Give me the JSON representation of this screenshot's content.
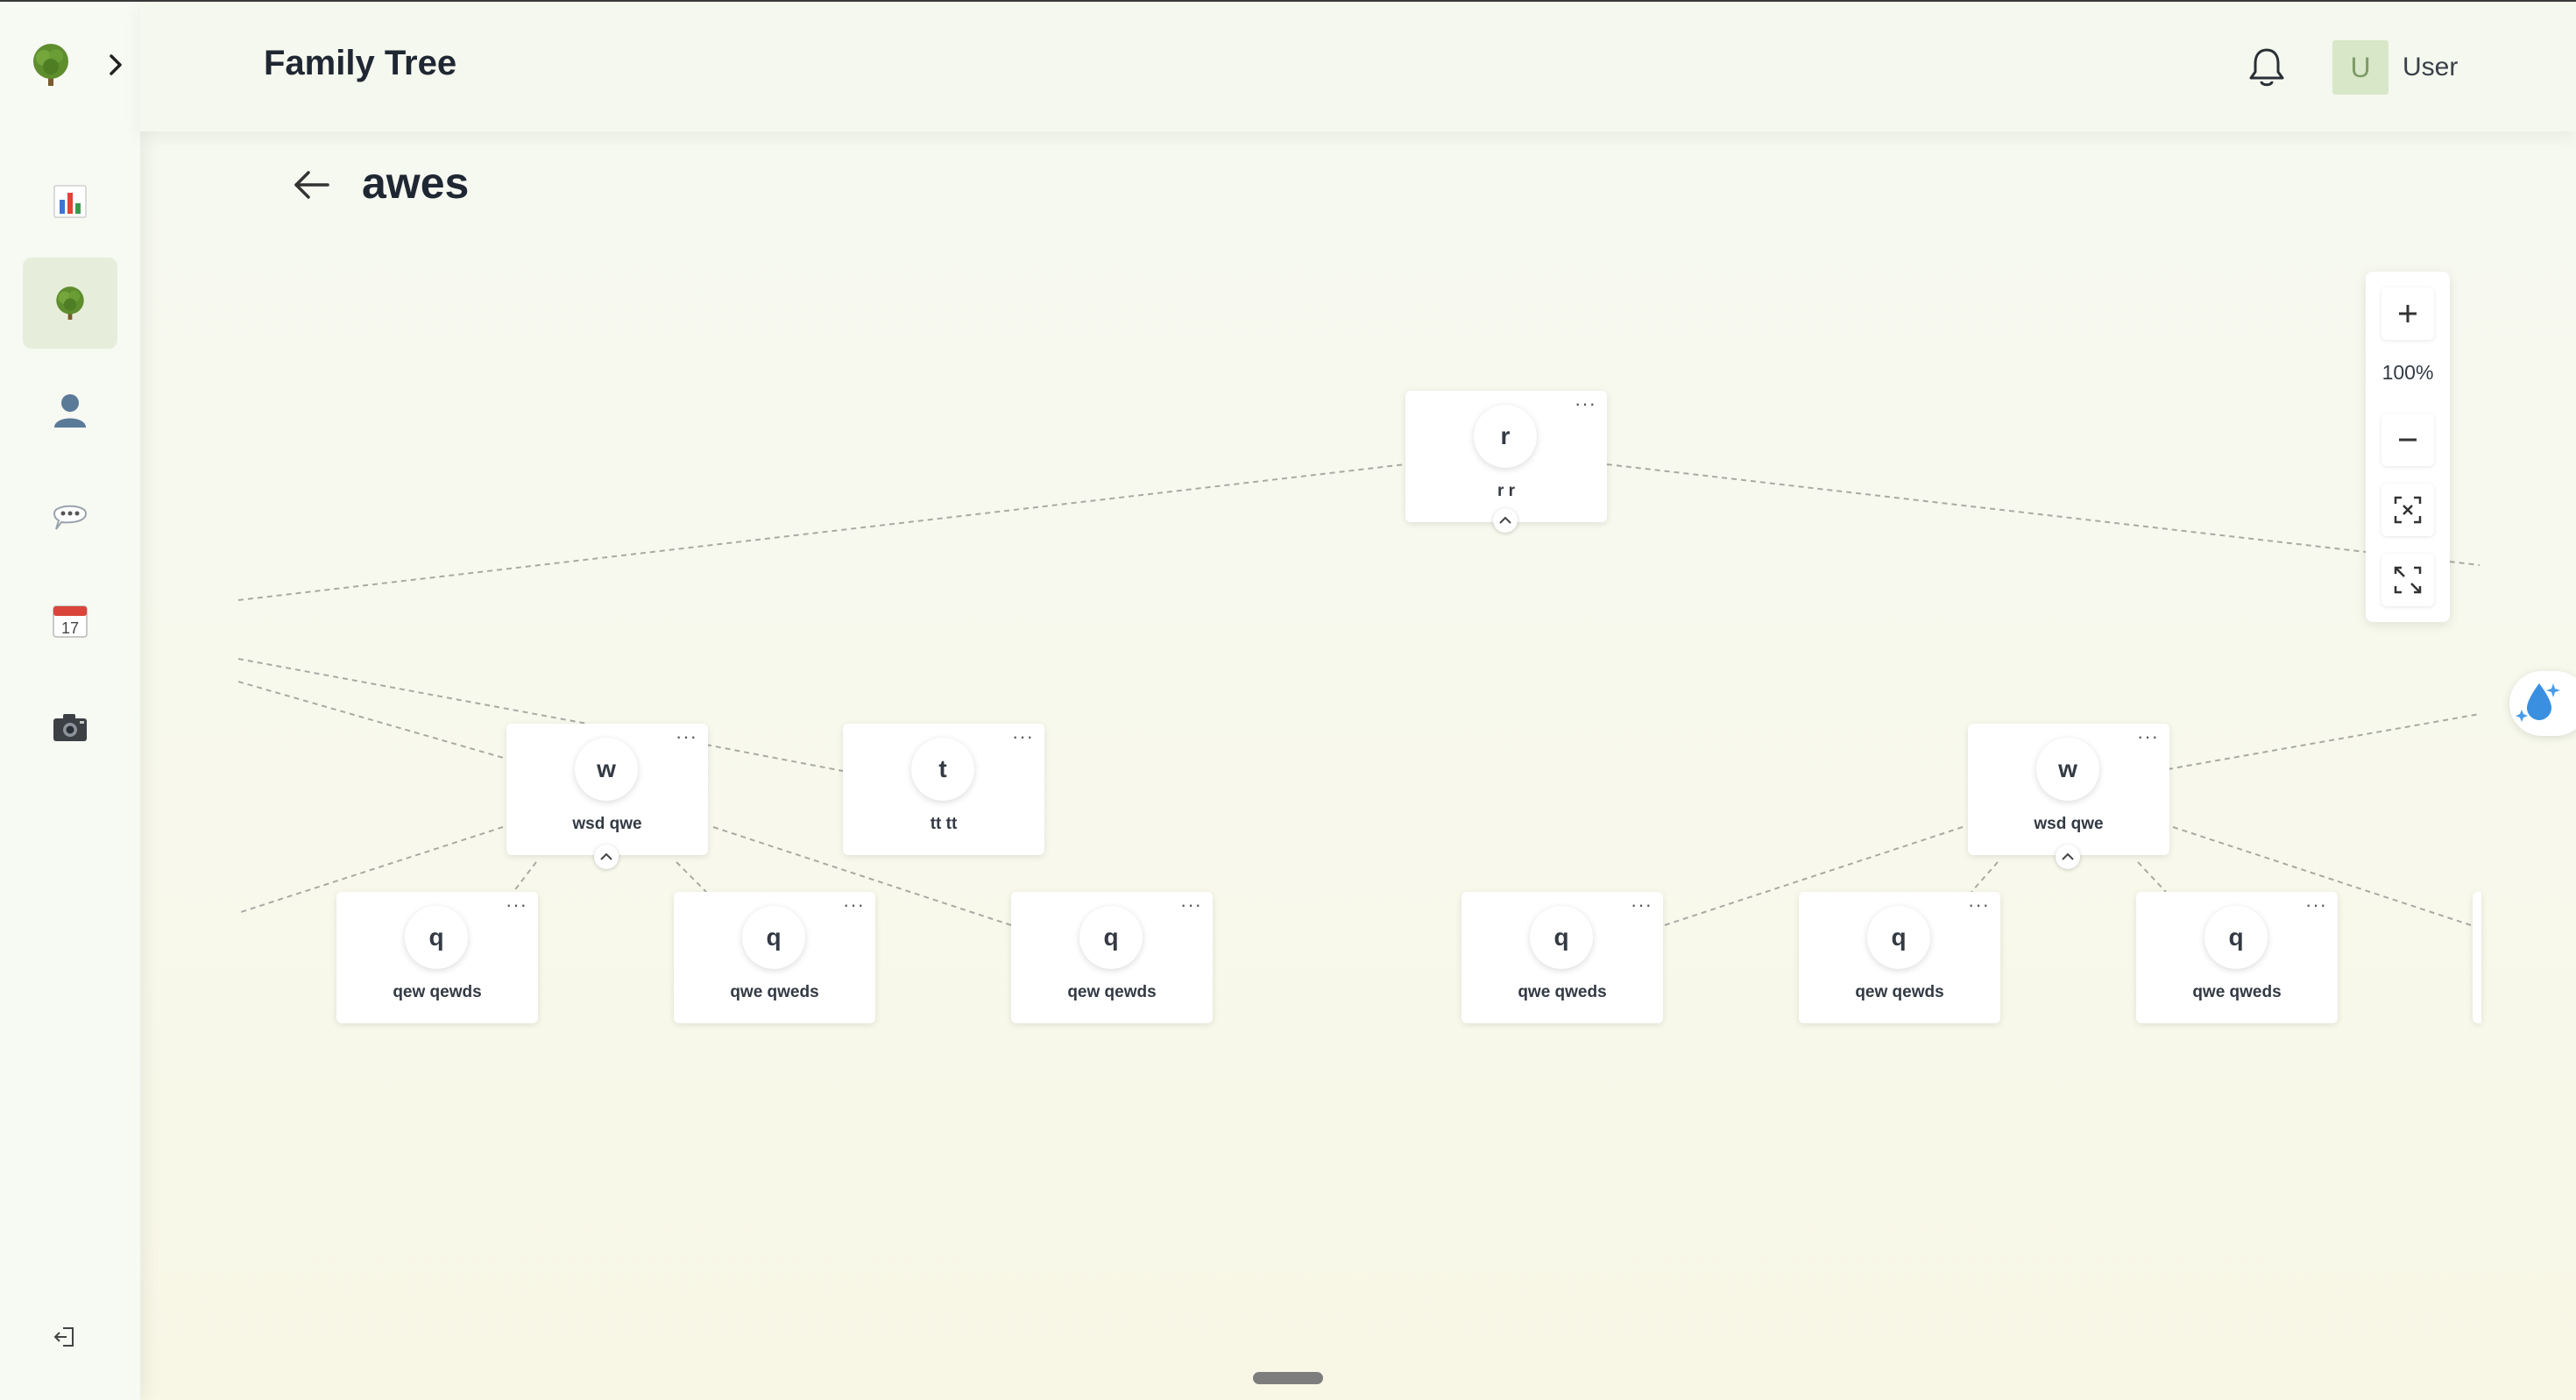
{
  "header": {
    "app_title": "Family Tree",
    "user_initial": "U",
    "user_name": "User"
  },
  "page": {
    "title": "awes"
  },
  "sidebar": {
    "items": [
      {
        "id": "dashboard",
        "icon": "bar-chart-icon"
      },
      {
        "id": "family-tree",
        "icon": "tree-icon",
        "active": true
      },
      {
        "id": "members",
        "icon": "person-icon"
      },
      {
        "id": "messages",
        "icon": "speech-bubble-icon"
      },
      {
        "id": "calendar",
        "icon": "calendar-icon",
        "day": "17"
      },
      {
        "id": "photos",
        "icon": "camera-icon"
      }
    ]
  },
  "tree": {
    "nodes": [
      {
        "id": "n1",
        "initial": "r",
        "name": "r r",
        "collapsible": true
      },
      {
        "id": "n2",
        "initial": "w",
        "name": "wsd qwe",
        "collapsible": true
      },
      {
        "id": "n3",
        "initial": "t",
        "name": "tt tt"
      },
      {
        "id": "n4",
        "initial": "w",
        "name": "wsd qwe",
        "collapsible": true
      },
      {
        "id": "n5",
        "initial": "q",
        "name": "qew qewds"
      },
      {
        "id": "n6",
        "initial": "q",
        "name": "qwe qweds"
      },
      {
        "id": "n7",
        "initial": "q",
        "name": "qew qewds"
      },
      {
        "id": "n8",
        "initial": "q",
        "name": "qwe qweds"
      },
      {
        "id": "n9",
        "initial": "q",
        "name": "qew qewds"
      },
      {
        "id": "n10",
        "initial": "q",
        "name": "qwe qweds"
      }
    ],
    "node_menu": "···"
  },
  "zoom": {
    "level": "100%",
    "zoom_in": "+",
    "zoom_out": "−"
  }
}
